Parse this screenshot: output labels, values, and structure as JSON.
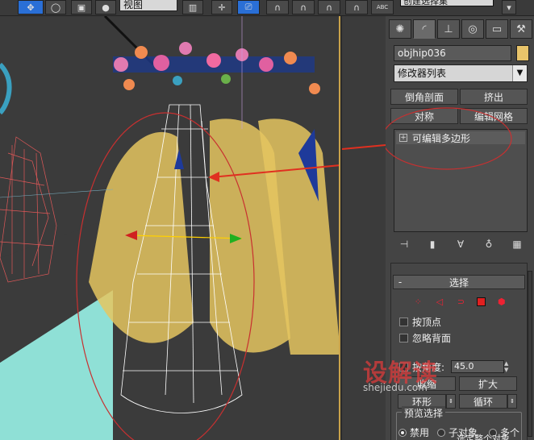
{
  "toolbar": {
    "view_dropdown": "视图",
    "named_selection": "创建选择集"
  },
  "panel": {
    "tabs": [
      {
        "icon": "sun-icon"
      },
      {
        "icon": "modify-curve-icon"
      },
      {
        "icon": "hierarchy-icon"
      },
      {
        "icon": "motion-icon"
      },
      {
        "icon": "display-icon"
      },
      {
        "icon": "utilities-hammer-icon"
      }
    ],
    "object_name": "objhip036",
    "object_color": "#e8c46a",
    "modifier_list": "修改器列表",
    "mod_buttons": {
      "chamfer_section": "倒角剖面",
      "extrude": "挤出",
      "symmetry": "对称",
      "edit_mesh": "编辑网格"
    },
    "stack": {
      "items": [
        {
          "label": "可编辑多边形"
        }
      ]
    },
    "selection": {
      "title": "选择",
      "by_vertex": "按顶点",
      "ignore_backfacing": "忽略背面",
      "by_angle": "按角度:",
      "angle_value": "45.0",
      "shrink": "收缩",
      "grow": "扩大",
      "ring": "环形",
      "loop": "循环",
      "preview_label": "预览选择",
      "preview_off": "禁用",
      "preview_subobj": "子对象",
      "preview_multi": "多个",
      "select_whole": "选定整个对象"
    }
  },
  "watermark": {
    "big": "设解读",
    "small": "shejiedu.com"
  }
}
